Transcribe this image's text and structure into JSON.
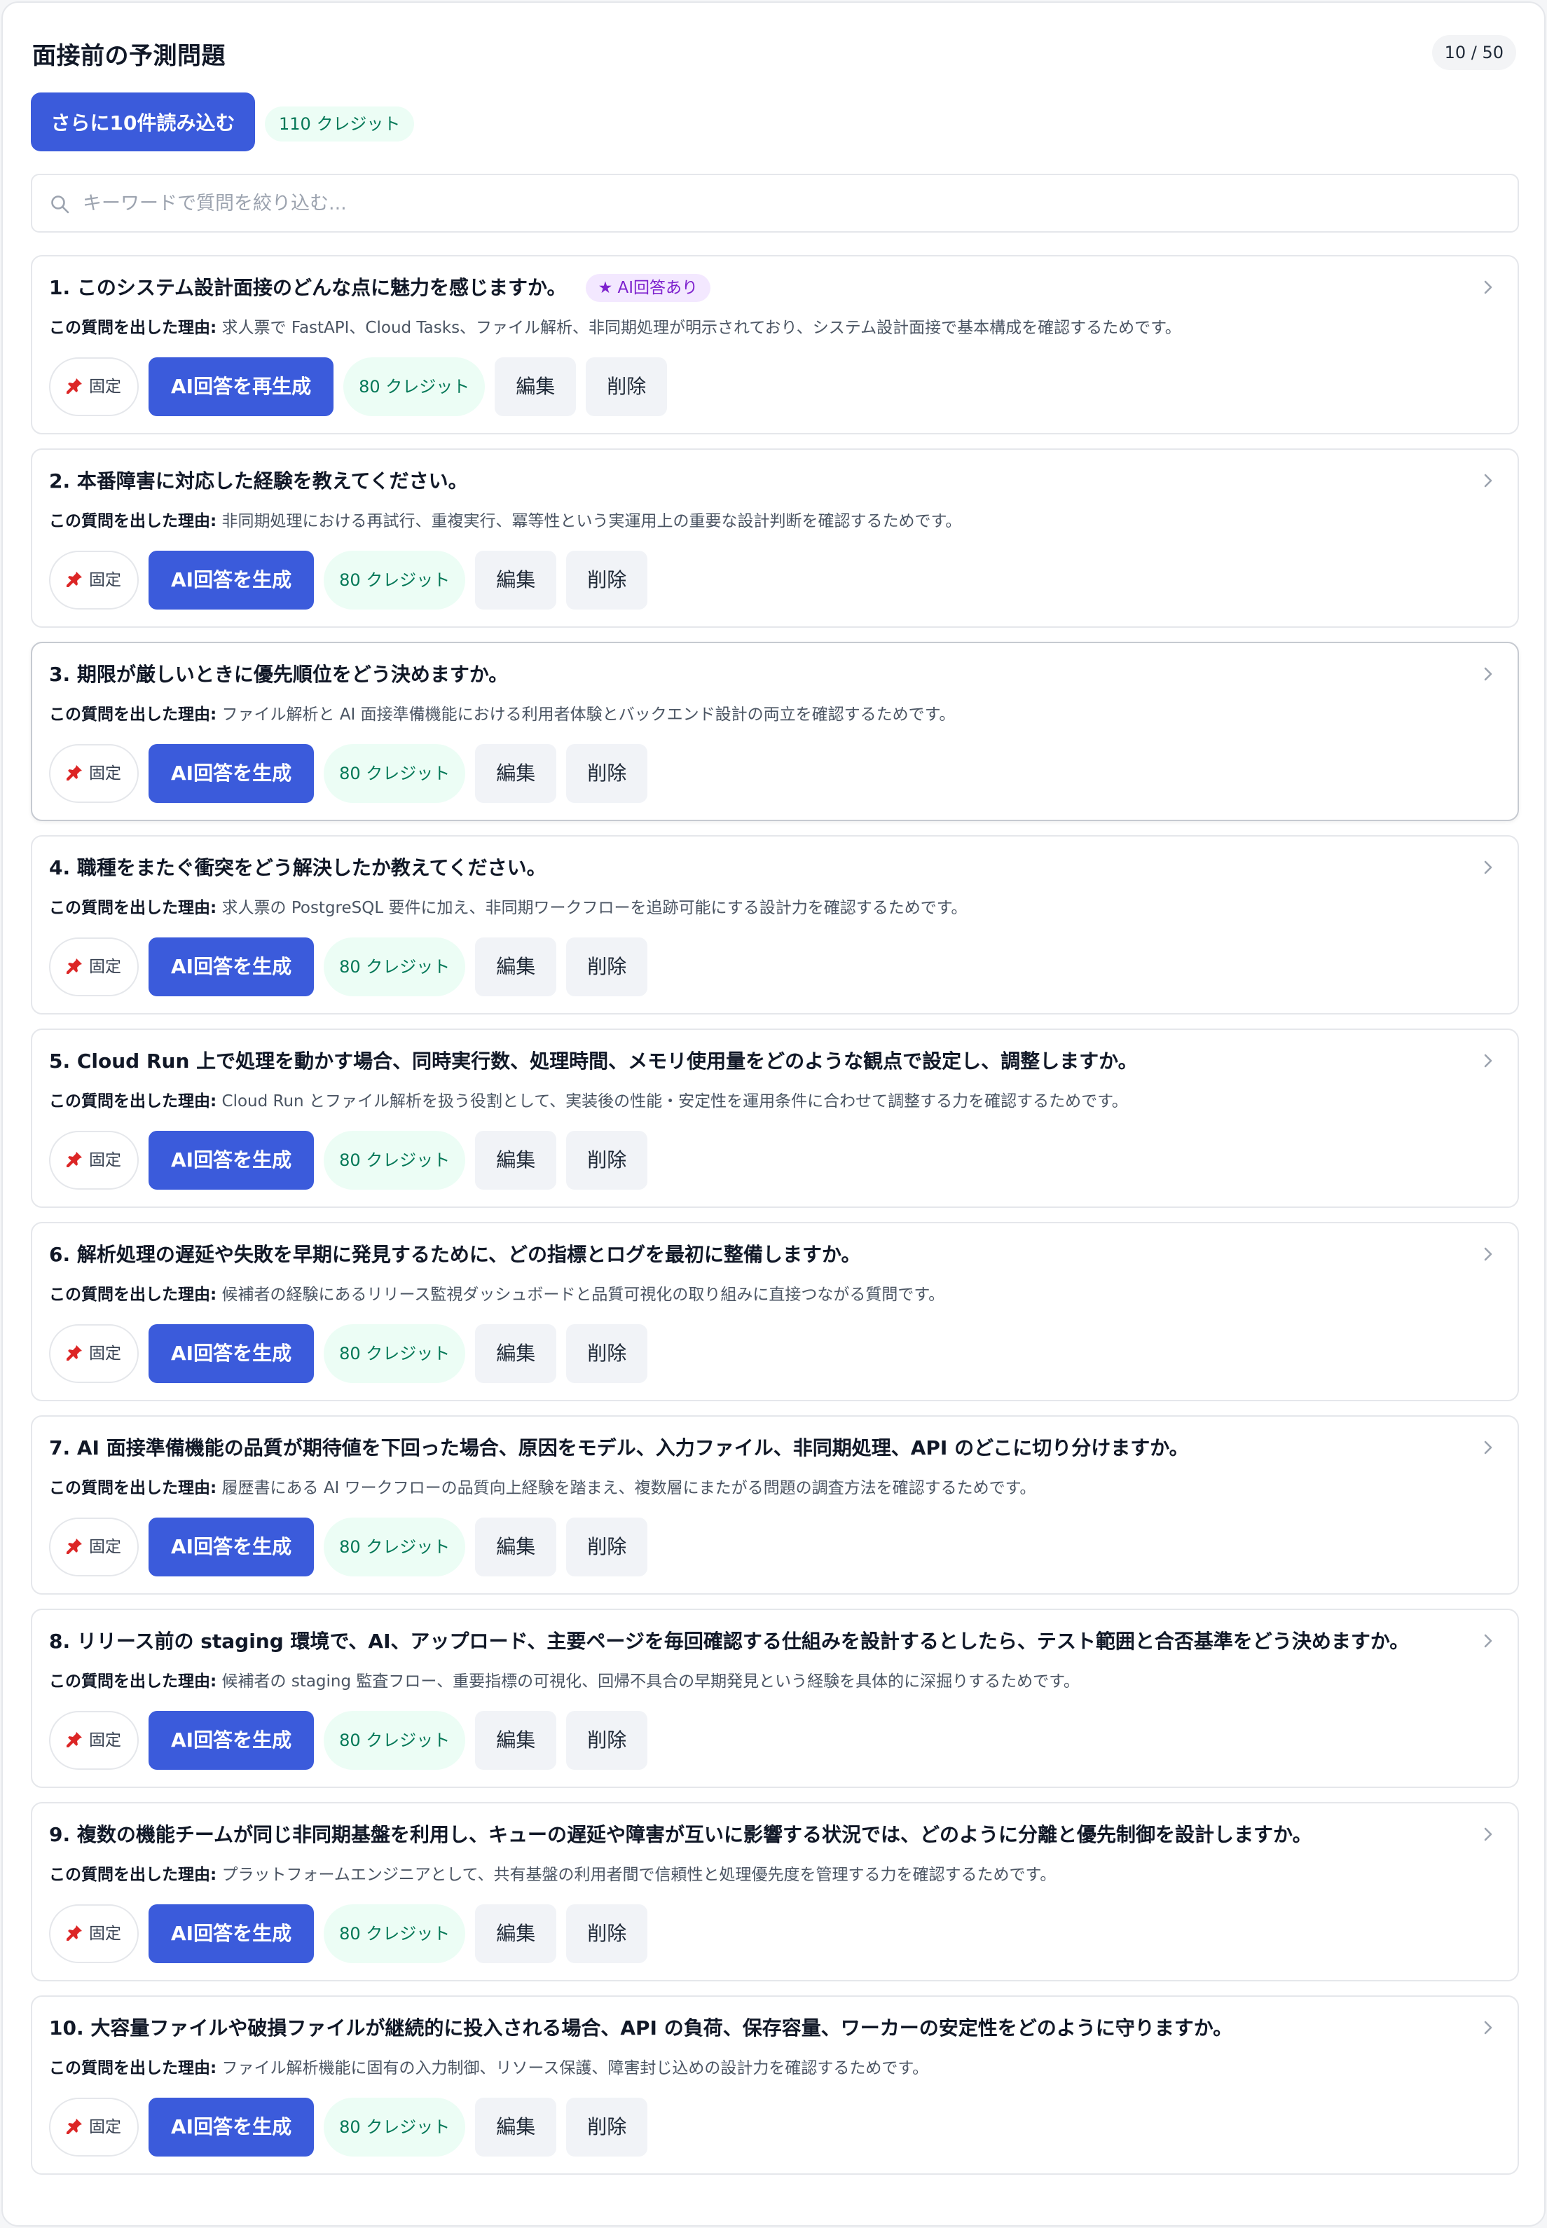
{
  "header": {
    "title": "面接前の予測問題",
    "counter": "10 / 50"
  },
  "toolbar": {
    "load_more_label": "さらに10件読み込む",
    "credits_label": "110 クレジット"
  },
  "search": {
    "placeholder": "キーワードで質問を絞り込む..."
  },
  "labels": {
    "reason_prefix": "この質問を出した理由:",
    "pin": "固定",
    "edit": "編集",
    "delete": "削除",
    "credit_cost": "80 クレジット",
    "ai_badge": "★ AI回答あり"
  },
  "icons": {
    "search": "search-icon",
    "pin": "pin-icon",
    "chevron": "chevron-right-icon"
  },
  "colors": {
    "primary": "#3b5bdb",
    "credit_bg": "#ecfdf5",
    "credit_text": "#047857",
    "badge_bg": "#f3e8ff",
    "badge_text": "#7e22ce",
    "pin": "#dc2626"
  },
  "questions": [
    {
      "title": "1. このシステム設計面接のどんな点に魅力を感じますか。",
      "reason": "求人票で FastAPI、Cloud Tasks、ファイル解析、非同期処理が明示されており、システム設計面接で基本構成を確認するためです。",
      "action_label": "AI回答を再生成",
      "has_ai_answer": true
    },
    {
      "title": "2. 本番障害に対応した経験を教えてください。",
      "reason": "非同期処理における再試行、重複実行、冪等性という実運用上の重要な設計判断を確認するためです。",
      "action_label": "AI回答を生成",
      "has_ai_answer": false
    },
    {
      "title": "3. 期限が厳しいときに優先順位をどう決めますか。",
      "reason": "ファイル解析と AI 面接準備機能における利用者体験とバックエンド設計の両立を確認するためです。",
      "action_label": "AI回答を生成",
      "has_ai_answer": false
    },
    {
      "title": "4. 職種をまたぐ衝突をどう解決したか教えてください。",
      "reason": "求人票の PostgreSQL 要件に加え、非同期ワークフローを追跡可能にする設計力を確認するためです。",
      "action_label": "AI回答を生成",
      "has_ai_answer": false
    },
    {
      "title": "5. Cloud Run 上で処理を動かす場合、同時実行数、処理時間、メモリ使用量をどのような観点で設定し、調整しますか。",
      "reason": "Cloud Run とファイル解析を扱う役割として、実装後の性能・安定性を運用条件に合わせて調整する力を確認するためです。",
      "action_label": "AI回答を生成",
      "has_ai_answer": false
    },
    {
      "title": "6. 解析処理の遅延や失敗を早期に発見するために、どの指標とログを最初に整備しますか。",
      "reason": "候補者の経験にあるリリース監視ダッシュボードと品質可視化の取り組みに直接つながる質問です。",
      "action_label": "AI回答を生成",
      "has_ai_answer": false
    },
    {
      "title": "7. AI 面接準備機能の品質が期待値を下回った場合、原因をモデル、入力ファイル、非同期処理、API のどこに切り分けますか。",
      "reason": "履歴書にある AI ワークフローの品質向上経験を踏まえ、複数層にまたがる問題の調査方法を確認するためです。",
      "action_label": "AI回答を生成",
      "has_ai_answer": false
    },
    {
      "title": "8. リリース前の staging 環境で、AI、アップロード、主要ページを毎回確認する仕組みを設計するとしたら、テスト範囲と合否基準をどう決めますか。",
      "reason": "候補者の staging 監査フロー、重要指標の可視化、回帰不具合の早期発見という経験を具体的に深掘りするためです。",
      "action_label": "AI回答を生成",
      "has_ai_answer": false
    },
    {
      "title": "9. 複数の機能チームが同じ非同期基盤を利用し、キューの遅延や障害が互いに影響する状況では、どのように分離と優先制御を設計しますか。",
      "reason": "プラットフォームエンジニアとして、共有基盤の利用者間で信頼性と処理優先度を管理する力を確認するためです。",
      "action_label": "AI回答を生成",
      "has_ai_answer": false
    },
    {
      "title": "10. 大容量ファイルや破損ファイルが継続的に投入される場合、API の負荷、保存容量、ワーカーの安定性をどのように守りますか。",
      "reason": "ファイル解析機能に固有の入力制御、リソース保護、障害封じ込めの設計力を確認するためです。",
      "action_label": "AI回答を生成",
      "has_ai_answer": false
    }
  ]
}
